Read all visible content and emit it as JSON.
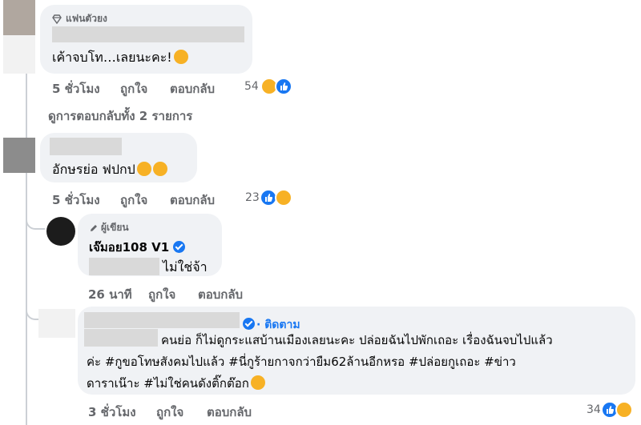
{
  "comments": [
    {
      "badge": "แฟนตัวยง",
      "text": "เค้าจบโท…เลยนะคะ!",
      "meta": {
        "time": "5 ชั่วโมง",
        "like": "ถูกใจ",
        "reply": "ตอบกลับ"
      },
      "reaction_count": "54"
    },
    {
      "view_replies": "ดูการตอบกลับทั้ง 2 รายการ"
    },
    {
      "text": "อักษรย่อ ฟปกป",
      "meta": {
        "time": "5 ชั่วโมง",
        "like": "ถูกใจ",
        "reply": "ตอบกลับ"
      },
      "reaction_count": "23"
    },
    {
      "badge": "ผู้เขียน",
      "author": "เจ๊มอย108 V1",
      "text": "ไม่ใช่จ้า",
      "meta": {
        "time": "26 นาที",
        "like": "ถูกใจ",
        "reply": "ตอบกลับ"
      }
    },
    {
      "follow": "· ติดตาม",
      "text_lines": [
        "คนย่อ ก็ไม่ดูกระแสบ้านเมืองเลยนะคะ ปล่อยฉันไปพักเถอะ เรื่องฉันจบไปแล้ว",
        "ค่ะ #กูขอโทษสังคมไปแล้ว #นี่กูร้ายกาจกว่ายืม62ล้านอีกหรอ #ปล่อยกูเถอะ #ข่าว",
        "ดาราเน๊าะ #ไม่ใช่คนดังติ๊กต๊อก"
      ],
      "meta": {
        "time": "3 ชั่วโมง",
        "like": "ถูกใจ",
        "reply": "ตอบกลับ"
      },
      "reaction_count": "34"
    }
  ],
  "colors": {
    "bubble": "#f0f2f5",
    "meta_text": "#65676b",
    "like_blue": "#1877f2",
    "haha_yellow": "#f7b125"
  },
  "icons": [
    "diamond-icon",
    "pen-icon",
    "verified-icon",
    "like-reaction-icon",
    "haha-reaction-icon",
    "laughing-emoji-icon",
    "rofl-emoji-icon",
    "grin-emoji-icon"
  ]
}
